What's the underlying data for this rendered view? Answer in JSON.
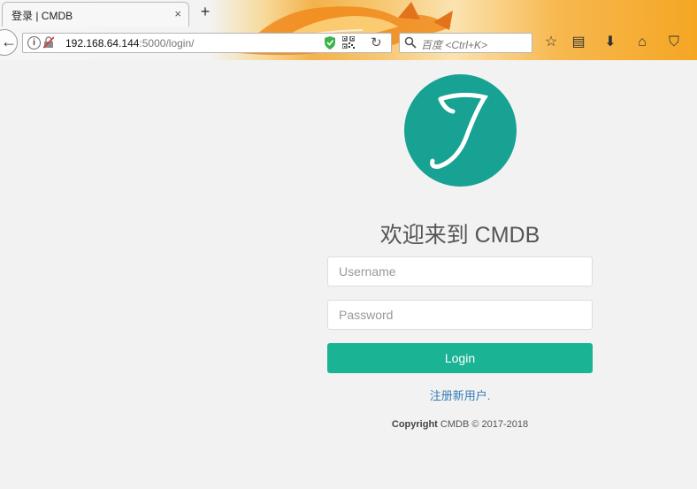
{
  "browser": {
    "tab_title": "登录 | CMDB",
    "tab_close": "×",
    "new_tab": "+",
    "url_host": "192.168.64.144",
    "url_rest": ":5000/login/",
    "search_placeholder": "百度 <Ctrl+K>",
    "back_glyph": "←",
    "reload_glyph": "↻",
    "info_glyph": "i",
    "icons": [
      "back-icon",
      "info-icon",
      "blocked-lock-icon",
      "shield-icon",
      "qr-code-icon",
      "reload-icon",
      "search-icon",
      "bookmark-star-icon",
      "reading-list-icon",
      "download-icon",
      "home-icon",
      "pocket-icon"
    ],
    "toolbar_glyphs": {
      "star": "☆",
      "reader": "▤",
      "download": "⬇",
      "home": "⌂",
      "pocket": "⛉"
    }
  },
  "page": {
    "logo_color": "#17a293",
    "welcome": "欢迎来到 CMDB",
    "username_placeholder": "Username",
    "password_placeholder": "Password",
    "login_label": "Login",
    "login_color": "#1ab394",
    "register_link": "注册新用户.",
    "copyright_bold": "Copyright",
    "copyright_text": " CMDB © 2017-2018"
  }
}
